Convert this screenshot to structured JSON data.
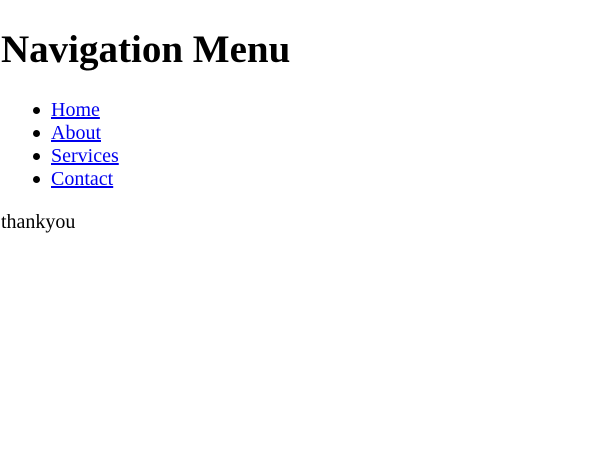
{
  "header": {
    "title": "Navigation Menu"
  },
  "nav": {
    "items": [
      {
        "label": "Home"
      },
      {
        "label": "About"
      },
      {
        "label": "Services"
      },
      {
        "label": "Contact"
      }
    ]
  },
  "footer": {
    "text": "thankyou"
  },
  "colors": {
    "link": "#0000ee",
    "text": "#000000",
    "background": "#ffffff"
  }
}
